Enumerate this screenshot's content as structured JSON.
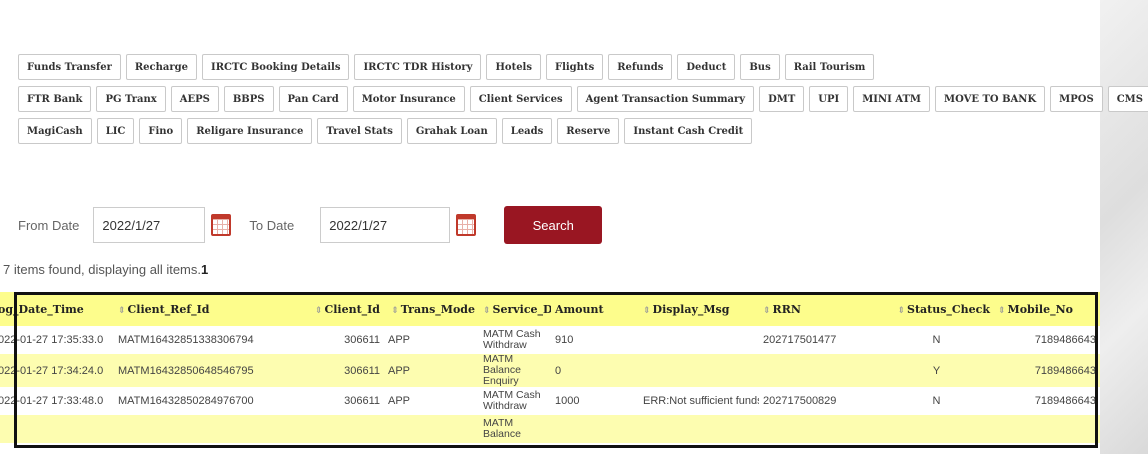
{
  "tabs": {
    "row1": [
      "Funds Transfer",
      "Recharge",
      "IRCTC Booking Details",
      "IRCTC TDR History",
      "Hotels",
      "Flights",
      "Refunds",
      "Deduct",
      "Bus",
      "Rail Tourism"
    ],
    "row2": [
      "FTR Bank",
      "PG Tranx",
      "AEPS",
      "BBPS",
      "Pan Card",
      "Motor Insurance",
      "Client Services",
      "Agent Transaction Summary",
      "DMT",
      "UPI",
      "MINI ATM",
      "MOVE TO BANK",
      "MPOS",
      "CMS"
    ],
    "row3": [
      "MagiCash",
      "LIC",
      "Fino",
      "Religare Insurance",
      "Travel Stats",
      "Grahak Loan",
      "Leads",
      "Reserve",
      "Instant Cash Credit"
    ]
  },
  "filters": {
    "from_label": "From Date",
    "from_value": "2022/1/27",
    "to_label": "To Date",
    "to_value": "2022/1/27",
    "search_label": "Search"
  },
  "results": {
    "summary": "7 items found, displaying all items.",
    "page": "1"
  },
  "table": {
    "headers": [
      "og_Date_Time",
      "Client_Ref_Id",
      "Client_Id",
      "Trans_Mode",
      "Service_Desc",
      "Amount",
      "Display_Msg",
      "RRN",
      "Status_Check",
      "Mobile_No"
    ],
    "rows": [
      {
        "date": "022-01-27 17:35:33.0",
        "ref": "MATM16432851338306794",
        "client_id": "306611",
        "mode": "APP",
        "service": "MATM Cash Withdraw",
        "amount": "910",
        "msg": "",
        "rrn": "202717501477",
        "status": "N",
        "mobile": "7189486643"
      },
      {
        "date": "022-01-27 17:34:24.0",
        "ref": "MATM16432850648546795",
        "client_id": "306611",
        "mode": "APP",
        "service": "MATM Balance Enquiry",
        "amount": "0",
        "msg": "",
        "rrn": "",
        "status": "Y",
        "mobile": "7189486643"
      },
      {
        "date": "022-01-27 17:33:48.0",
        "ref": "MATM16432850284976700",
        "client_id": "306611",
        "mode": "APP",
        "service": "MATM Cash Withdraw",
        "amount": "1000",
        "msg": "ERR:Not sufficient funds",
        "rrn": "202717500829",
        "status": "N",
        "mobile": "7189486643"
      },
      {
        "date": "",
        "ref": "",
        "client_id": "",
        "mode": "",
        "service": "MATM Balance",
        "amount": "",
        "msg": "",
        "rrn": "",
        "status": "",
        "mobile": ""
      }
    ]
  }
}
